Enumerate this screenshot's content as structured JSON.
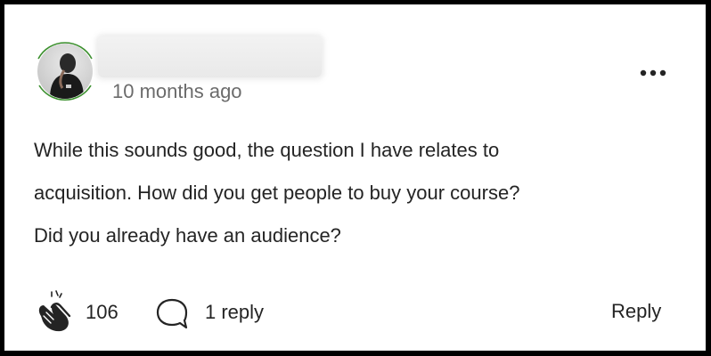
{
  "comment": {
    "timestamp": "10 months ago",
    "text_lines": [
      "While this sounds good, the question I have relates to",
      "acquisition. How did you get people to buy your course?",
      "Did you already have an audience?"
    ]
  },
  "actions": {
    "clap_count": "106",
    "reply_count_label": "1 reply",
    "reply_label": "Reply"
  },
  "icons": {
    "avatar": "user-avatar",
    "more": "more-horizontal-icon",
    "clap": "clap-icon",
    "reply": "speech-bubble-icon"
  },
  "colors": {
    "ring": "#3a8f2c",
    "text": "#242424",
    "muted": "#6b6b6b"
  }
}
